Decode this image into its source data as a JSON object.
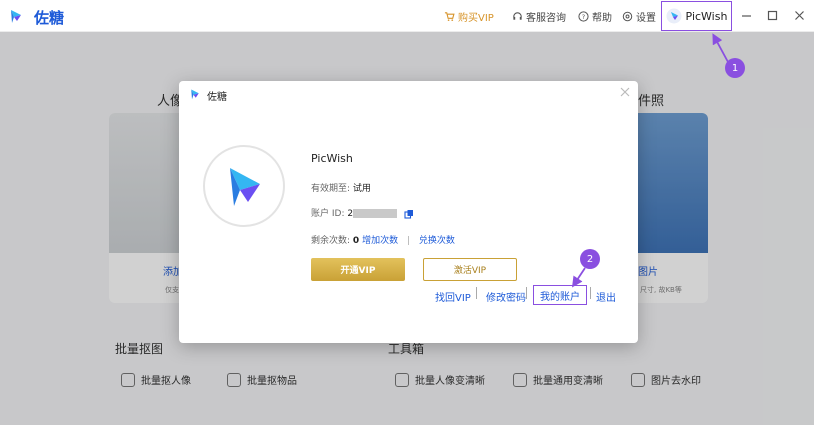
{
  "titlebar": {
    "app_name": "佐糖",
    "buy_vip": "购买VIP",
    "support": "客服咨询",
    "help": "帮助",
    "settings": "设置",
    "account_name": "PicWish"
  },
  "background": {
    "left_heading": "人像",
    "right_heading": "件照",
    "left_card_link": "添加",
    "left_card_sub": "仅支",
    "right_card_link": "图片",
    "right_card_sub": "尺寸, 故KB等",
    "batch_title": "批量抠图",
    "tools_title": "工具箱",
    "tools": [
      "批量抠人像",
      "批量抠物品",
      "批量人像变清晰",
      "批量通用变清晰",
      "图片去水印"
    ]
  },
  "dialog": {
    "title": "佐糖",
    "product": "PicWish",
    "validity_label": "有效期至:",
    "validity_value": "试用",
    "account_id_label": "账户 ID:",
    "account_id_value": "2",
    "remaining_label": "剩余次数:",
    "remaining_value": "0",
    "add_times": "增加次数",
    "redeem_times": "兑换次数",
    "open_vip": "开通VIP",
    "activate_vip": "激活VIP",
    "link_retrieve_vip": "找回VIP",
    "link_change_password": "修改密码",
    "link_my_account": "我的账户",
    "link_logout": "退出"
  },
  "steps": [
    "1",
    "2"
  ],
  "colors": {
    "brand_blue": "#1e5bd8",
    "vip_gold": "#c9a136",
    "annotation_purple": "#8a4fe0"
  }
}
